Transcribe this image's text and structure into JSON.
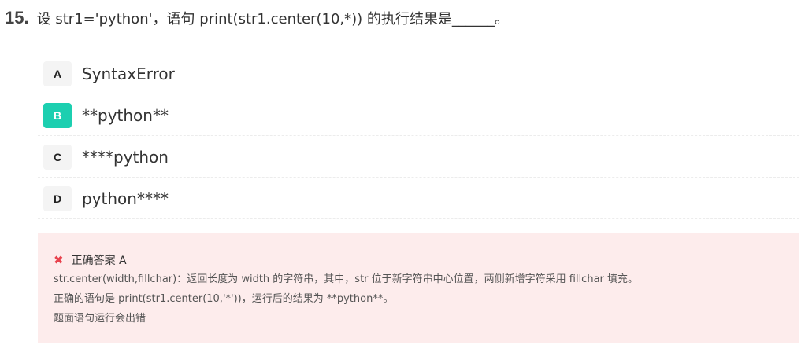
{
  "question": {
    "number": "15.",
    "text": "设 str1='python'，语句 print(str1.center(10,*)) 的执行结果是______。"
  },
  "options": [
    {
      "letter": "A",
      "text": "SyntaxError",
      "selected": false
    },
    {
      "letter": "B",
      "text": "**python**",
      "selected": true
    },
    {
      "letter": "C",
      "text": "****python",
      "selected": false
    },
    {
      "letter": "D",
      "text": "python****",
      "selected": false
    }
  ],
  "answer": {
    "icon": "close-icon",
    "label": "正确答案 A",
    "explanation": [
      "str.center(width,fillchar)：返回长度为 width 的字符串，其中，str 位于新字符串中心位置，两侧新增字符采用 fillchar 填充。",
      "正确的语句是 print(str1.center(10,'*'))，运行后的结果为 **python**。",
      "题面语句运行会出错"
    ]
  },
  "colors": {
    "selected_option": "#1ccfb0",
    "wrong_icon": "#e8424d",
    "answer_background": "#fdecec"
  }
}
